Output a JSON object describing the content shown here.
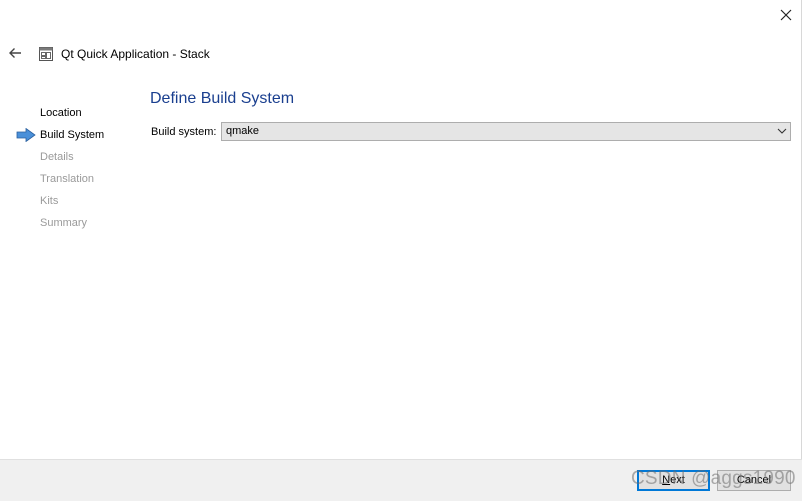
{
  "window": {
    "title": "Qt Quick Application - Stack"
  },
  "icons": {
    "close": "close-icon",
    "back": "back-arrow-icon",
    "app": "qt-creator-wizard-icon",
    "current_step": "right-arrow-icon",
    "dropdown": "chevron-down-icon"
  },
  "steps": [
    {
      "label": "Location",
      "state": "done"
    },
    {
      "label": "Build System",
      "state": "current"
    },
    {
      "label": "Details",
      "state": "pending"
    },
    {
      "label": "Translation",
      "state": "pending"
    },
    {
      "label": "Kits",
      "state": "pending"
    },
    {
      "label": "Summary",
      "state": "pending"
    }
  ],
  "page": {
    "title": "Define Build System",
    "build_system_label": "Build system:",
    "build_system_value": "qmake"
  },
  "footer": {
    "next_label_prefix": "",
    "next_label_underlined": "N",
    "next_label_rest": "ext",
    "cancel_label": "Cancel"
  },
  "watermark": "CSDN @aggs1990",
  "colors": {
    "title_blue": "#1a3f8f",
    "arrow_blue": "#4a90d9",
    "focus_blue": "#0078d7",
    "footer_bg": "#f0f0f0"
  }
}
